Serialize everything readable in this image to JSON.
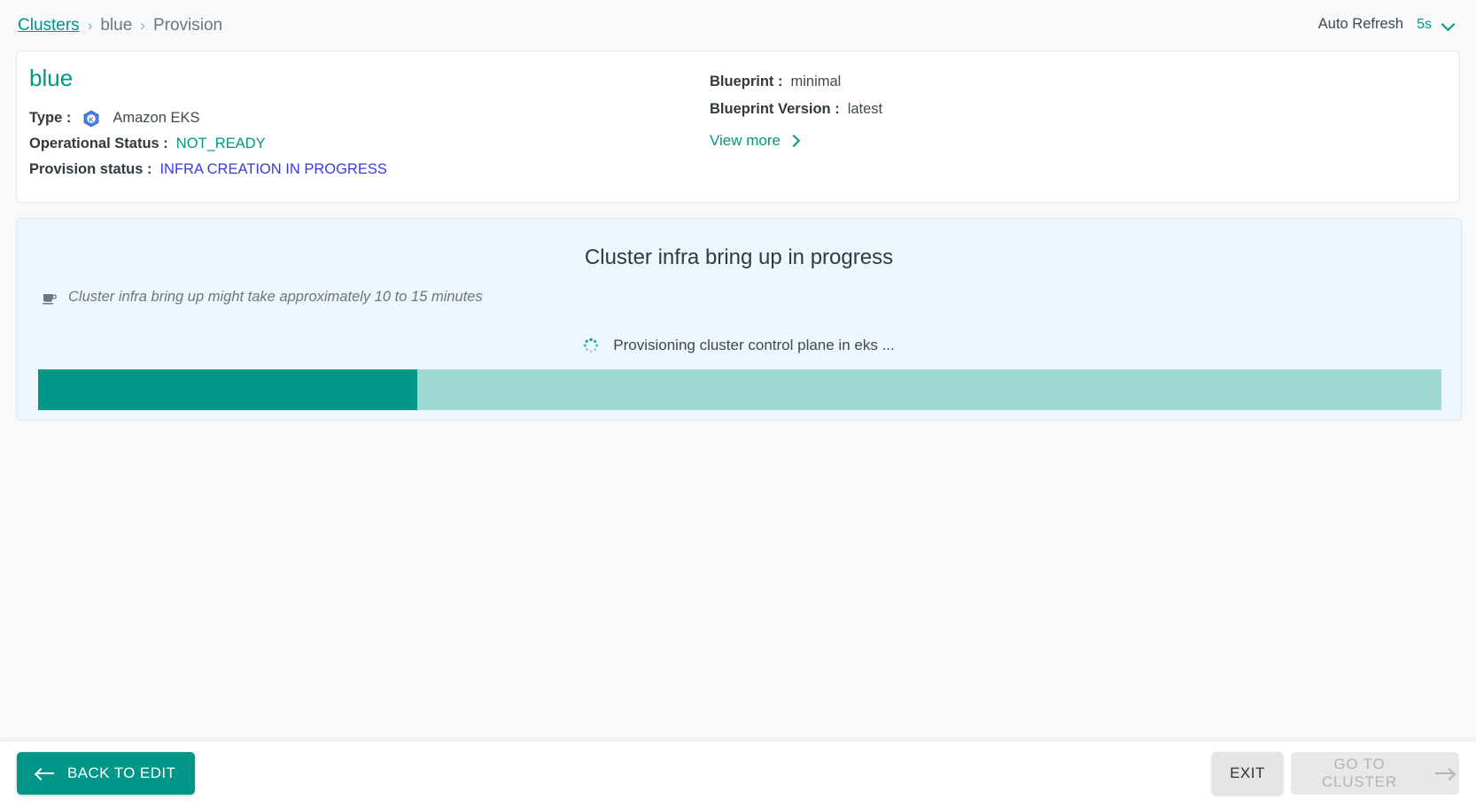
{
  "breadcrumb": {
    "root": "Clusters",
    "separator": "›",
    "cluster": "blue",
    "current": "Provision"
  },
  "auto_refresh": {
    "label": "Auto Refresh",
    "value": "5s",
    "chevron_icon": "chevron-down-icon"
  },
  "cluster_card": {
    "name": "blue",
    "type_label": "Type :",
    "type_icon": "kubernetes-icon",
    "type_value": "Amazon EKS",
    "operational_status_label": "Operational Status :",
    "operational_status_value": "NOT_READY",
    "provision_status_label": "Provision status :",
    "provision_status_value": "INFRA CREATION IN PROGRESS",
    "blueprint_label": "Blueprint :",
    "blueprint_value": "minimal",
    "blueprint_version_label": "Blueprint Version :",
    "blueprint_version_value": "latest",
    "view_more_label": "View more",
    "view_more_icon": "chevron-right-icon"
  },
  "progress_panel": {
    "title": "Cluster infra bring up in progress",
    "hint_icon": "coffee-cup-icon",
    "hint_text": "Cluster infra bring up might take approximately 10 to 15 minutes",
    "spinner_icon": "loading-spinner-icon",
    "status_text": "Provisioning cluster control plane in eks ...",
    "progress_percent": 27
  },
  "footer": {
    "back_label": "BACK TO EDIT",
    "back_icon": "arrow-left-icon",
    "exit_label": "EXIT",
    "goto_label": "GO TO CLUSTER",
    "goto_icon": "arrow-right-icon"
  },
  "colors": {
    "accent_teal": "#009688",
    "link_blue": "#3a3ae8",
    "panel_bg": "#edf5fd",
    "progress_track": "#9fd8d0"
  }
}
